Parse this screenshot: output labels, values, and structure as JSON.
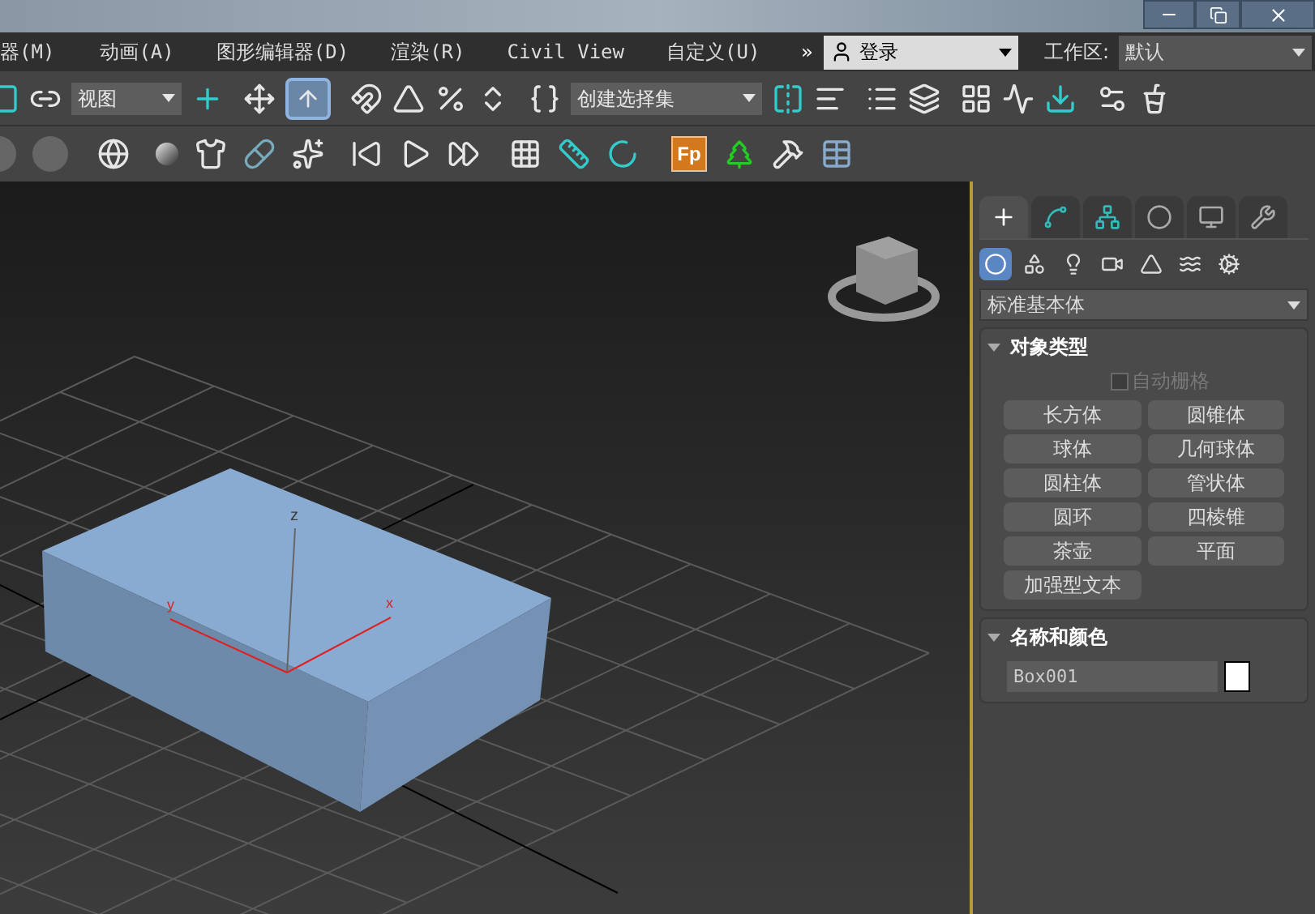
{
  "menu_bar": {
    "items": [
      "器(M)",
      "动画(A)",
      "图形编辑器(D)",
      "渲染(R)",
      "Civil View",
      "自定义(U)"
    ],
    "overflow": "»",
    "sign_in": {
      "value": "登录"
    },
    "workspace": {
      "label": "工作区:",
      "value": "默认"
    }
  },
  "main_toolbar": {
    "view_dropdown": "视图",
    "place_tool": {
      "selected": true
    },
    "selection_set_dropdown": "创建选择集"
  },
  "secondary_toolbar": {
    "badge_label": "Fp"
  },
  "viewport": {
    "axis_labels": [
      "z",
      "y",
      "x"
    ]
  },
  "command_panel": {
    "tabs": [
      {
        "kind": "create",
        "selected": true
      },
      {
        "kind": "modify",
        "selected": false
      },
      {
        "kind": "hierarchy",
        "selected": false
      },
      {
        "kind": "motion",
        "selected": false
      },
      {
        "kind": "display",
        "selected": false
      },
      {
        "kind": "utilities",
        "selected": false
      }
    ],
    "categories": [
      {
        "kind": "geometry",
        "selected": true
      },
      {
        "kind": "shapes",
        "selected": false
      },
      {
        "kind": "lights",
        "selected": false
      },
      {
        "kind": "cameras",
        "selected": false
      },
      {
        "kind": "helpers",
        "selected": false
      },
      {
        "kind": "space_warps",
        "selected": false
      },
      {
        "kind": "systems",
        "selected": false
      }
    ],
    "category_dropdown": "标准基本体",
    "object_type": {
      "title": "对象类型",
      "auto_grid": {
        "label": "自动栅格",
        "checked": false,
        "disabled": true
      },
      "buttons": [
        "长方体",
        "圆锥体",
        "球体",
        "几何球体",
        "圆柱体",
        "管状体",
        "圆环",
        "四棱锥",
        "茶壶",
        "平面",
        "加强型文本"
      ]
    },
    "name_and_color": {
      "title": "名称和颜色",
      "name": "Box001",
      "color": "#ffffff"
    }
  }
}
